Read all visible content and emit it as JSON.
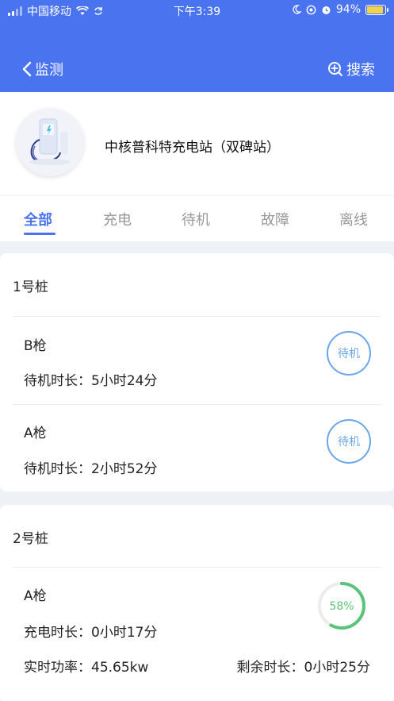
{
  "status_bar": {
    "carrier": "中国移动",
    "time": "下午3:39",
    "battery": "94%",
    "battery_level": 0.94
  },
  "nav": {
    "back_label": "监测",
    "search_label": "搜索"
  },
  "station": {
    "name": "中核普科特充电站（双碑站）"
  },
  "tabs": [
    {
      "label": "全部",
      "active": true
    },
    {
      "label": "充电",
      "active": false
    },
    {
      "label": "待机",
      "active": false
    },
    {
      "label": "故障",
      "active": false
    },
    {
      "label": "离线",
      "active": false
    }
  ],
  "piles": [
    {
      "title": "1号桩",
      "guns": [
        {
          "name": "B枪",
          "info": "待机时长：5小时24分",
          "status": "待机"
        },
        {
          "name": "A枪",
          "info": "待机时长：2小时52分",
          "status": "待机"
        }
      ]
    },
    {
      "title": "2号桩",
      "guns": [
        {
          "name": "A枪",
          "info": "充电时长：0小时17分",
          "power": "实时功率：45.65kw",
          "remaining": "剩余时长：0小时25分",
          "progress_label": "58%",
          "progress": 0.58
        }
      ]
    }
  ],
  "colors": {
    "primary": "#4a73f0",
    "idle": "#6aa6e8",
    "charging": "#5cc47a"
  }
}
